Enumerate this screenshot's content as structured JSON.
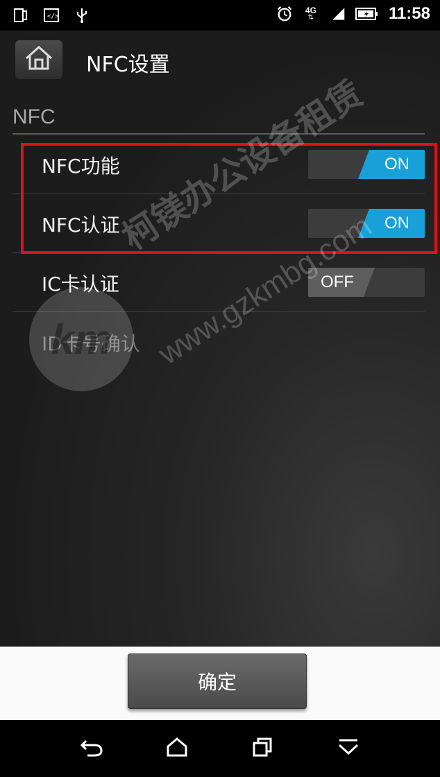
{
  "status_bar": {
    "time": "11:58",
    "network": "4G",
    "left_icons": [
      "phone-icon",
      "code-icon",
      "usb-icon"
    ],
    "right_icons": [
      "alarm-icon",
      "network-4g-icon",
      "signal-icon",
      "battery-icon"
    ]
  },
  "header": {
    "title": "NFC设置",
    "home_icon": "home-icon"
  },
  "section": {
    "title": "NFC"
  },
  "settings": [
    {
      "label": "NFC功能",
      "state": "ON"
    },
    {
      "label": "NFC认证",
      "state": "ON"
    },
    {
      "label": "IC卡认证",
      "state": "OFF"
    },
    {
      "label": "ID卡号确认"
    }
  ],
  "watermark": {
    "logo": "km",
    "line1": "柯镁办公设备租赁",
    "line2": "www.gzkmbg.com"
  },
  "footer": {
    "confirm_label": "确定"
  },
  "colors": {
    "accent": "#1aa0d8",
    "highlight": "#e0101a",
    "background": "#1e1e1e"
  },
  "navbar": {
    "icons": [
      "back-icon",
      "home-icon",
      "recent-apps-icon",
      "hide-keyboard-icon"
    ]
  }
}
